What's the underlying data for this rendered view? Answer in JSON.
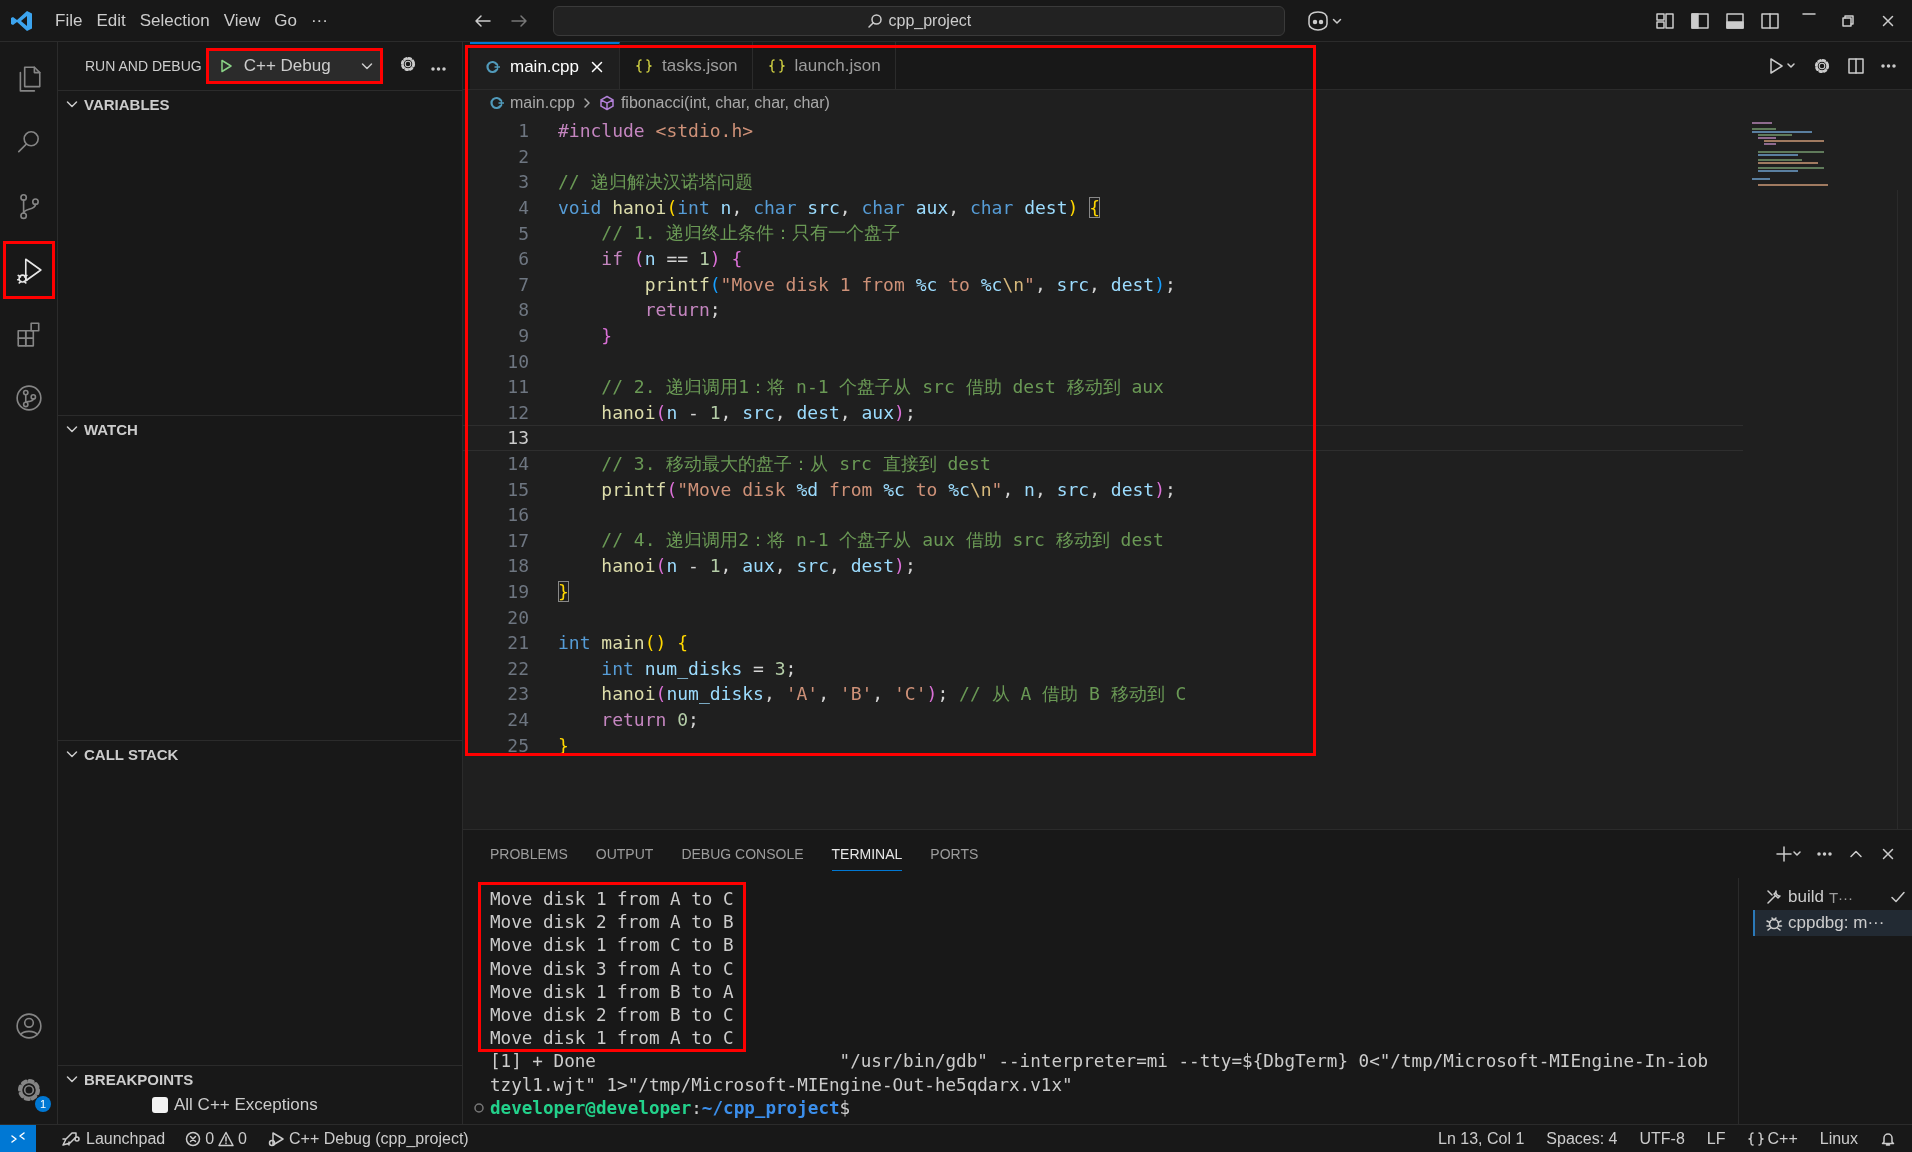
{
  "title_bar": {
    "menu": [
      "File",
      "Edit",
      "Selection",
      "View",
      "Go",
      "···"
    ],
    "search": "cpp_project"
  },
  "activity_bar": {
    "top": [
      {
        "kind": "explorer",
        "selected": false,
        "highlighted": false
      },
      {
        "kind": "search",
        "selected": false,
        "highlighted": false
      },
      {
        "kind": "source-control",
        "selected": false,
        "highlighted": false
      },
      {
        "kind": "run-debug",
        "selected": true,
        "highlighted": true
      },
      {
        "kind": "extensions",
        "selected": false,
        "highlighted": false
      },
      {
        "kind": "git-graph",
        "selected": false,
        "highlighted": false
      }
    ],
    "bottom": [
      {
        "kind": "accounts"
      },
      {
        "kind": "manage",
        "badge": "1"
      }
    ]
  },
  "sidebar": {
    "title": "RUN AND DEBUG",
    "configuration": {
      "label": "C++ Debug",
      "highlighted": true
    },
    "sections": [
      {
        "title": "VARIABLES",
        "expanded": true
      },
      {
        "title": "WATCH",
        "expanded": true
      },
      {
        "title": "CALL STACK",
        "expanded": true
      },
      {
        "title": "BREAKPOINTS",
        "expanded": true,
        "items": [
          {
            "label": "All C++ Exceptions",
            "checked": false
          }
        ]
      }
    ]
  },
  "editor": {
    "highlighted": true,
    "tabs": [
      {
        "label": "main.cpp",
        "kind": "cpp",
        "selected": true
      },
      {
        "label": "tasks.json",
        "kind": "json",
        "selected": false
      },
      {
        "label": "launch.json",
        "kind": "json",
        "selected": false
      }
    ],
    "breadcrumb": [
      {
        "label": "main.cpp",
        "kind": "cpp"
      },
      {
        "label": "fibonacci(int, char, char, char)",
        "kind": "symbol"
      }
    ],
    "lines": [
      {
        "number": "1",
        "current": false,
        "tokens": [
          {
            "kind": "ctl",
            "text": "#include"
          },
          {
            "kind": "str",
            "text": " <stdio.h>"
          }
        ]
      },
      {
        "number": "2",
        "current": false
      },
      {
        "number": "3",
        "current": false,
        "tokens": [
          {
            "kind": "cm",
            "text": "// 递归解决汉诺塔问题"
          }
        ]
      },
      {
        "number": "4",
        "current": false,
        "tokens": [
          {
            "kind": "kw",
            "text": "void"
          },
          {
            "kind": "fn",
            "text": " hanoi"
          },
          {
            "kind": "b1",
            "text": "("
          },
          {
            "kind": "kw",
            "text": "int"
          },
          {
            "kind": "var",
            "text": " n"
          },
          {
            "kind": "p",
            "text": ", "
          },
          {
            "kind": "kw",
            "text": "char"
          },
          {
            "kind": "var",
            "text": " src"
          },
          {
            "kind": "p",
            "text": ", "
          },
          {
            "kind": "kw",
            "text": "char"
          },
          {
            "kind": "var",
            "text": " aux"
          },
          {
            "kind": "p",
            "text": ", "
          },
          {
            "kind": "kw",
            "text": "char"
          },
          {
            "kind": "var",
            "text": " dest"
          },
          {
            "kind": "b1",
            "text": ") "
          },
          {
            "kind": "b1m",
            "text": "{"
          }
        ]
      },
      {
        "number": "5",
        "current": false,
        "tokens": [
          {
            "kind": "cm",
            "text": "    // 1. 递归终止条件：只有一个盘子"
          }
        ]
      },
      {
        "number": "6",
        "current": false,
        "tokens": [
          {
            "kind": "ctl",
            "text": "    if"
          },
          {
            "kind": "b2",
            "text": " ("
          },
          {
            "kind": "var",
            "text": "n"
          },
          {
            "kind": "p",
            "text": " == "
          },
          {
            "kind": "num",
            "text": "1"
          },
          {
            "kind": "b2",
            "text": ") {"
          }
        ]
      },
      {
        "number": "7",
        "current": false,
        "tokens": [
          {
            "kind": "fn",
            "text": "        printf"
          },
          {
            "kind": "b3",
            "text": "("
          },
          {
            "kind": "str",
            "text": "\"Move disk 1 from "
          },
          {
            "kind": "fmt",
            "text": "%c"
          },
          {
            "kind": "str",
            "text": " to "
          },
          {
            "kind": "fmt",
            "text": "%c"
          },
          {
            "kind": "esc",
            "text": "\\n"
          },
          {
            "kind": "str",
            "text": "\""
          },
          {
            "kind": "p",
            "text": ", "
          },
          {
            "kind": "var",
            "text": "src"
          },
          {
            "kind": "p",
            "text": ", "
          },
          {
            "kind": "var",
            "text": "dest"
          },
          {
            "kind": "b3",
            "text": ")"
          },
          {
            "kind": "p",
            "text": ";"
          }
        ]
      },
      {
        "number": "8",
        "current": false,
        "tokens": [
          {
            "kind": "ctl",
            "text": "        return"
          },
          {
            "kind": "p",
            "text": ";"
          }
        ]
      },
      {
        "number": "9",
        "current": false,
        "tokens": [
          {
            "kind": "b2",
            "text": "    }"
          }
        ]
      },
      {
        "number": "10",
        "current": false
      },
      {
        "number": "11",
        "current": false,
        "tokens": [
          {
            "kind": "cm",
            "text": "    // 2. 递归调用1：将 n-1 个盘子从 src 借助 dest 移动到 aux"
          }
        ]
      },
      {
        "number": "12",
        "current": false,
        "tokens": [
          {
            "kind": "fn",
            "text": "    hanoi"
          },
          {
            "kind": "b2",
            "text": "("
          },
          {
            "kind": "var",
            "text": "n"
          },
          {
            "kind": "p",
            "text": " - "
          },
          {
            "kind": "num",
            "text": "1"
          },
          {
            "kind": "p",
            "text": ", "
          },
          {
            "kind": "var",
            "text": "src"
          },
          {
            "kind": "p",
            "text": ", "
          },
          {
            "kind": "var",
            "text": "dest"
          },
          {
            "kind": "p",
            "text": ", "
          },
          {
            "kind": "var",
            "text": "aux"
          },
          {
            "kind": "b2",
            "text": ")"
          },
          {
            "kind": "p",
            "text": ";"
          }
        ]
      },
      {
        "number": "13",
        "current": true
      },
      {
        "number": "14",
        "current": false,
        "tokens": [
          {
            "kind": "cm",
            "text": "    // 3. 移动最大的盘子：从 src 直接到 dest"
          }
        ]
      },
      {
        "number": "15",
        "current": false,
        "tokens": [
          {
            "kind": "fn",
            "text": "    printf"
          },
          {
            "kind": "b2",
            "text": "("
          },
          {
            "kind": "str",
            "text": "\"Move disk "
          },
          {
            "kind": "fmt",
            "text": "%d"
          },
          {
            "kind": "str",
            "text": " from "
          },
          {
            "kind": "fmt",
            "text": "%c"
          },
          {
            "kind": "str",
            "text": " to "
          },
          {
            "kind": "fmt",
            "text": "%c"
          },
          {
            "kind": "esc",
            "text": "\\n"
          },
          {
            "kind": "str",
            "text": "\""
          },
          {
            "kind": "p",
            "text": ", "
          },
          {
            "kind": "var",
            "text": "n"
          },
          {
            "kind": "p",
            "text": ", "
          },
          {
            "kind": "var",
            "text": "src"
          },
          {
            "kind": "p",
            "text": ", "
          },
          {
            "kind": "var",
            "text": "dest"
          },
          {
            "kind": "b2",
            "text": ")"
          },
          {
            "kind": "p",
            "text": ";"
          }
        ]
      },
      {
        "number": "16",
        "current": false
      },
      {
        "number": "17",
        "current": false,
        "tokens": [
          {
            "kind": "cm",
            "text": "    // 4. 递归调用2：将 n-1 个盘子从 aux 借助 src 移动到 dest"
          }
        ]
      },
      {
        "number": "18",
        "current": false,
        "tokens": [
          {
            "kind": "fn",
            "text": "    hanoi"
          },
          {
            "kind": "b2",
            "text": "("
          },
          {
            "kind": "var",
            "text": "n"
          },
          {
            "kind": "p",
            "text": " - "
          },
          {
            "kind": "num",
            "text": "1"
          },
          {
            "kind": "p",
            "text": ", "
          },
          {
            "kind": "var",
            "text": "aux"
          },
          {
            "kind": "p",
            "text": ", "
          },
          {
            "kind": "var",
            "text": "src"
          },
          {
            "kind": "p",
            "text": ", "
          },
          {
            "kind": "var",
            "text": "dest"
          },
          {
            "kind": "b2",
            "text": ")"
          },
          {
            "kind": "p",
            "text": ";"
          }
        ]
      },
      {
        "number": "19",
        "current": false,
        "tokens": [
          {
            "kind": "b1m",
            "text": "}"
          }
        ]
      },
      {
        "number": "20",
        "current": false
      },
      {
        "number": "21",
        "current": false,
        "tokens": [
          {
            "kind": "kw",
            "text": "int"
          },
          {
            "kind": "fn",
            "text": " main"
          },
          {
            "kind": "b1",
            "text": "() {"
          }
        ]
      },
      {
        "number": "22",
        "current": false,
        "tokens": [
          {
            "kind": "kw",
            "text": "    int"
          },
          {
            "kind": "var",
            "text": " num_disks"
          },
          {
            "kind": "p",
            "text": " = "
          },
          {
            "kind": "num",
            "text": "3"
          },
          {
            "kind": "p",
            "text": ";"
          }
        ]
      },
      {
        "number": "23",
        "current": false,
        "tokens": [
          {
            "kind": "fn",
            "text": "    hanoi"
          },
          {
            "kind": "b2",
            "text": "("
          },
          {
            "kind": "var",
            "text": "num_disks"
          },
          {
            "kind": "p",
            "text": ", "
          },
          {
            "kind": "str",
            "text": "'A'"
          },
          {
            "kind": "p",
            "text": ", "
          },
          {
            "kind": "str",
            "text": "'B'"
          },
          {
            "kind": "p",
            "text": ", "
          },
          {
            "kind": "str",
            "text": "'C'"
          },
          {
            "kind": "b2",
            "text": ")"
          },
          {
            "kind": "p",
            "text": "; "
          },
          {
            "kind": "cm",
            "text": "// 从 A 借助 B 移动到 C"
          }
        ]
      },
      {
        "number": "24",
        "current": false,
        "tokens": [
          {
            "kind": "ctl",
            "text": "    return"
          },
          {
            "kind": "num",
            "text": " 0"
          },
          {
            "kind": "p",
            "text": ";"
          }
        ]
      },
      {
        "number": "25",
        "current": false,
        "tokens": [
          {
            "kind": "b1",
            "text": "}"
          }
        ]
      }
    ]
  },
  "panel": {
    "tabs": [
      {
        "label": "PROBLEMS",
        "selected": false
      },
      {
        "label": "OUTPUT",
        "selected": false
      },
      {
        "label": "DEBUG CONSOLE",
        "selected": false
      },
      {
        "label": "TERMINAL",
        "selected": true
      },
      {
        "label": "PORTS",
        "selected": false
      }
    ],
    "terminal": {
      "output": {
        "highlighted": true,
        "lines": [
          "Move disk 1 from A to C",
          "Move disk 2 from A to B",
          "Move disk 1 from C to B",
          "Move disk 3 from A to C",
          "Move disk 1 from B to A",
          "Move disk 2 from B to C",
          "Move disk 1 from A to C"
        ]
      },
      "lines": [
        "[1] + Done                       \"/usr/bin/gdb\" --interpreter=mi --tty=${DbgTerm} 0<\"/tmp/Microsoft-MIEngine-In-iob",
        "tzyl1.wjt\" 1>\"/tmp/Microsoft-MIEngine-Out-he5qdarx.v1x\""
      ],
      "prompt": {
        "user": "developer@developer",
        "separator": ":",
        "path": "~/cpp_project",
        "symbol": "$"
      }
    },
    "sessions": [
      {
        "kind": "task",
        "label": "build",
        "detail": "T···",
        "selected": false
      },
      {
        "kind": "debug",
        "label": "cppdbg: m···",
        "selected": true
      }
    ]
  },
  "status_bar": {
    "left": [
      {
        "kind": "remote"
      },
      {
        "kind": "launchpad",
        "label": "Launchpad"
      },
      {
        "kind": "problems",
        "errors": "0",
        "warnings": "0"
      },
      {
        "kind": "debug",
        "label": "C++ Debug (cpp_project)"
      }
    ],
    "right": [
      {
        "kind": "text",
        "label": "Ln 13, Col 1"
      },
      {
        "kind": "text",
        "label": "Spaces: 4"
      },
      {
        "kind": "text",
        "label": "UTF-8"
      },
      {
        "kind": "text",
        "label": "LF"
      },
      {
        "kind": "language",
        "label": "C++"
      },
      {
        "kind": "text",
        "label": "Linux"
      },
      {
        "kind": "bell"
      }
    ]
  }
}
